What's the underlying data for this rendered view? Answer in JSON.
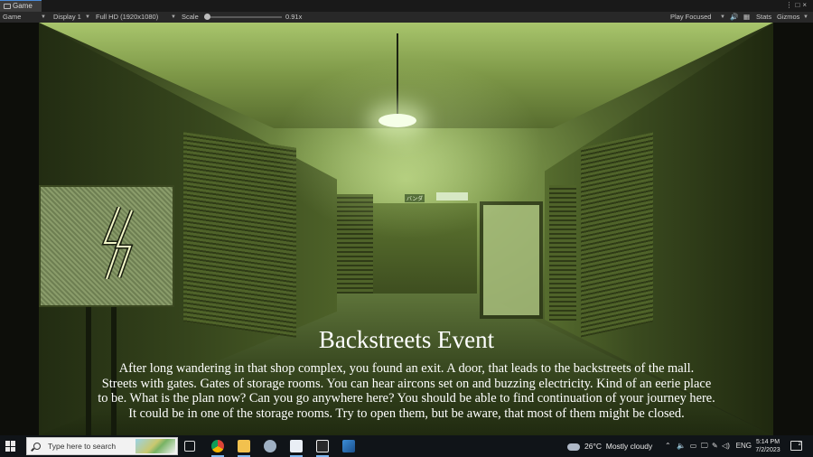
{
  "editor": {
    "tab_label": "Game",
    "toolbar": {
      "view_select": "Game",
      "display_select": "Display 1",
      "resolution_select": "Full HD (1920x1080)",
      "scale_label": "Scale",
      "scale_value": "0.91x",
      "scale_fraction": 0.02,
      "play_mode_select": "Play Focused",
      "stats_label": "Stats",
      "gizmos_label": "Gizmos"
    }
  },
  "game": {
    "event_title": "Backstreets Event",
    "event_body_lines": [
      "After long wandering in that shop complex, you found an exit. A door, that leads to the backstreets of the mall.",
      "Streets with gates. Gates of storage rooms. You can hear aircons set on and buzzing electricity. Kind of an eerie place",
      "to be. What is the plan now? Can you go anywhere here? You should be able to find continuation of your journey here.",
      "It could be in one of the storage rooms. Try to open them, but be aware, that most of them might be closed."
    ],
    "sign_text": "バンダ"
  },
  "taskbar": {
    "search_placeholder": "Type here to search",
    "weather_temp": "26°C",
    "weather_desc": "Mostly cloudy",
    "language": "ENG",
    "time": "5:14 PM",
    "date": "7/2/2023",
    "notification_count": "2",
    "pinned_apps": [
      "task-view",
      "chrome",
      "file-explorer",
      "app-bird",
      "app-document",
      "unity",
      "photos"
    ]
  }
}
